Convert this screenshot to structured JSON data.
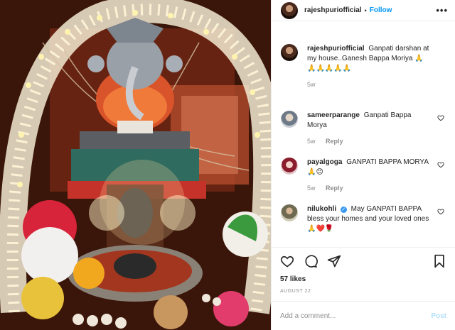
{
  "post": {
    "image_alt_label": "Ganpati idol photo",
    "author": "rajeshpuriofficial",
    "separator": "•",
    "follow_label": "Follow",
    "more_label": "•••"
  },
  "comments": [
    {
      "user": "rajeshpuriofficial",
      "text": "Ganpati darshan at my house..Ganesh Bappa Moriya 🙏 🙏🙏🙏🙏🙏",
      "time": "5w",
      "reply": "",
      "verified": false,
      "avatar_icon": "profile-avatar"
    },
    {
      "user": "sameerparange",
      "text": "Ganpati Bappa Morya",
      "time": "5w",
      "reply": "Reply",
      "verified": false,
      "avatar_icon": "profile-avatar"
    },
    {
      "user": "payalgoga",
      "text": "GANPATI BAPPA MORYA 🙏😊",
      "time": "5w",
      "reply": "Reply",
      "verified": false,
      "avatar_icon": "profile-avatar"
    },
    {
      "user": "nilukohli",
      "text": "May GANPATI BAPPA bless your homes and your loved ones🙏❤️🌹",
      "time": "",
      "reply": "",
      "verified": true,
      "avatar_icon": "profile-avatar"
    }
  ],
  "actions": {
    "like_icon": "heart-outline-icon",
    "comment_icon": "speech-bubble-icon",
    "share_icon": "paper-plane-icon",
    "save_icon": "bookmark-icon"
  },
  "stats": {
    "likes": "57 likes",
    "date": "AUGUST 22"
  },
  "add_comment": {
    "placeholder": "Add a comment...",
    "post_label": "Post"
  },
  "colors": {
    "link_blue": "#0095f6",
    "post_disabled": "#b2dffc",
    "meta_grey": "#8e8e8e",
    "verified_blue": "#3897f0"
  }
}
